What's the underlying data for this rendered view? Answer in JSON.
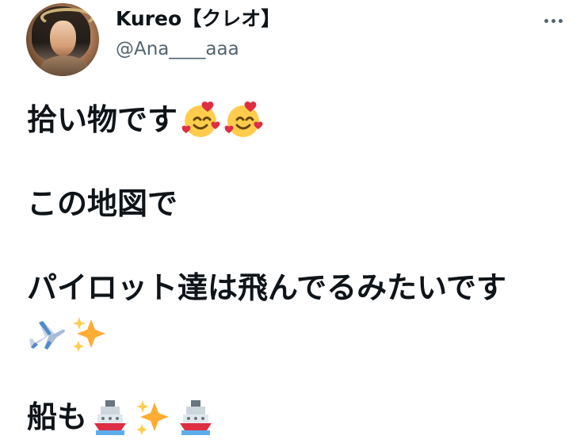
{
  "user": {
    "display_name": "Kureo【クレオ】",
    "handle": "@Ana____aaa",
    "avatar": "profile-photo"
  },
  "actions": {
    "more_icon": "more-icon"
  },
  "tweet": {
    "line1_text": "拾い物です",
    "line2_text": "この地図で",
    "line3_text": "パイロット達は飛んでるみたいです",
    "line5_text": "船も",
    "emojis": {
      "smile": "smiling-face-with-hearts-icon",
      "plane": "airplane-icon",
      "sparkles": "sparkles-icon",
      "ship": "ship-icon"
    }
  },
  "colors": {
    "text": "#0f1419",
    "secondary": "#536471",
    "background": "#ffffff"
  }
}
